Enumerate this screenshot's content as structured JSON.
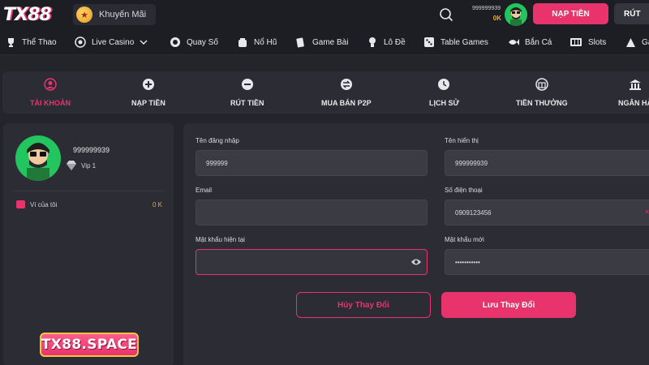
{
  "header": {
    "logo_text": "TX88",
    "promo_label": "Khuyến Mãi",
    "account_name": "999999939",
    "balance": "0K",
    "deposit_label": "NẠP TIỀN",
    "withdraw_label": "RÚT"
  },
  "categories": [
    {
      "label": "Thể Thao",
      "icon": "trophy-icon"
    },
    {
      "label": "Live Casino",
      "icon": "casino-chip-icon"
    },
    {
      "label": "Quay Số",
      "icon": "lottery-ball-icon"
    },
    {
      "label": "Nổ Hũ",
      "icon": "jar-icon"
    },
    {
      "label": "Game Bài",
      "icon": "cards-icon"
    },
    {
      "label": "Lô Đề",
      "icon": "lotto-icon"
    },
    {
      "label": "Table Games",
      "icon": "dice-icon"
    },
    {
      "label": "Bắn Cá",
      "icon": "fish-icon"
    },
    {
      "label": "Slots",
      "icon": "slot-machine-icon"
    },
    {
      "label": "Ga",
      "icon": "game-icon"
    }
  ],
  "tabs": [
    {
      "label": "TÀI KHOẢN",
      "icon": "user-icon",
      "active": true
    },
    {
      "label": "NẠP TIỀN",
      "icon": "plus-circle-icon"
    },
    {
      "label": "RÚT TIỀN",
      "icon": "minus-circle-icon"
    },
    {
      "label": "MUA BÁN P2P",
      "icon": "swap-icon"
    },
    {
      "label": "LỊCH SỬ",
      "icon": "clock-icon"
    },
    {
      "label": "TIỀN THƯỞNG",
      "icon": "gift-icon"
    },
    {
      "label": "NGÂN HÀ",
      "icon": "bank-icon"
    }
  ],
  "profile": {
    "username": "999999939",
    "vip": "Vip 1",
    "wallet_label": "Ví của tôi",
    "wallet_value": "0 K"
  },
  "watermark": "TX88.SPACE",
  "form": {
    "username_label": "Tên đăng nhập",
    "username_value": "999999",
    "display_label": "Tên hiển thị",
    "display_value": "999999939",
    "email_label": "Email",
    "email_value": "",
    "phone_label": "Số điện thoại",
    "phone_value": "0909123456",
    "current_pw_label": "Mật khẩu hiện tại",
    "current_pw_value": "",
    "new_pw_label": "Mật khẩu mới",
    "new_pw_value": "•••••••••••",
    "cancel_label": "Hủy Thay Đổi",
    "save_label": "Lưu Thay Đổi"
  },
  "colors": {
    "accent": "#e8336c",
    "balance": "#f5a623",
    "avatar_bg": "#22c55e"
  }
}
